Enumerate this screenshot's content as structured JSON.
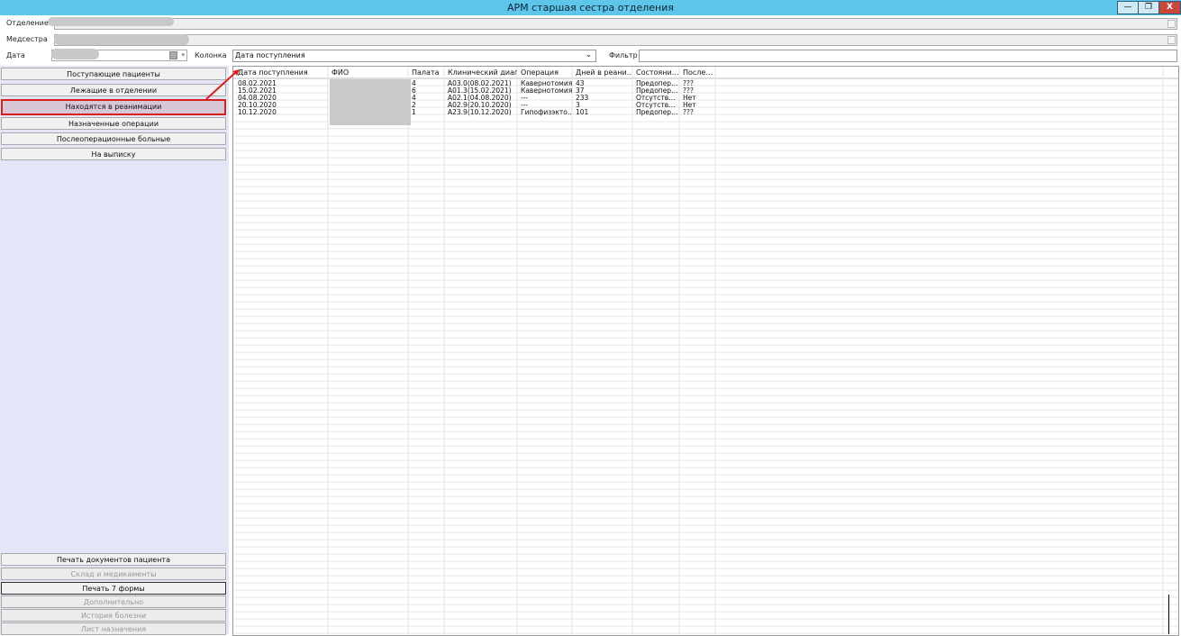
{
  "window": {
    "title": "АРМ старшая сестра отделения",
    "minimize_label": "—",
    "maximize_label": "❐",
    "close_label": "X"
  },
  "filters": {
    "department_label": "Отделение",
    "nurse_label": "Медсестра",
    "date_label": "Дата",
    "column_label": "Колонка",
    "column_value": "Дата поступления",
    "filter_label": "Фильтр",
    "filter_value": ""
  },
  "nav": {
    "top": [
      {
        "label": "Поступающие пациенты"
      },
      {
        "label": "Лежащие в отделении"
      },
      {
        "label": "Находятся в реанимации"
      },
      {
        "label": "Назначенные операции"
      },
      {
        "label": "Послеоперационные больные"
      },
      {
        "label": "На выписку"
      }
    ],
    "bottom": [
      {
        "label": "Печать документов пациента"
      },
      {
        "label": "Склад и медикаменты"
      },
      {
        "label": "Печать 7 формы"
      },
      {
        "label": "Дополнительно"
      },
      {
        "label": "История болезни"
      },
      {
        "label": "Лист назначения"
      }
    ]
  },
  "table": {
    "columns": [
      "Дата поступления",
      "ФИО",
      "Палата",
      "Клинический диаг…",
      "Операция",
      "Дней в реани…",
      "Состояни…",
      "После…"
    ],
    "rows": [
      [
        "08.02.2021",
        "",
        "4",
        "A03.0(08.02.2021)",
        "Кавернотомия",
        "43",
        "Предопер…",
        "???"
      ],
      [
        "15.02.2021",
        "",
        "6",
        "A01.3(15.02.2021)",
        "Кавернотомия",
        "37",
        "Предопер…",
        "???"
      ],
      [
        "04.08.2020",
        "",
        "4",
        "A02.1(04.08.2020)",
        "---",
        "233",
        "Отсутств…",
        "Нет"
      ],
      [
        "20.10.2020",
        "",
        "2",
        "A02.9(20.10.2020)",
        "---",
        "3",
        "Отсутств…",
        "Нет"
      ],
      [
        "10.12.2020",
        "",
        "1",
        "A23.9(10.12.2020)",
        "Гипофизэкто…",
        "101",
        "Предопер…",
        "???"
      ]
    ]
  },
  "colors": {
    "titlebar": "#5ec6ea",
    "sidebar": "#e4e5f6",
    "highlight": "#d8211f"
  }
}
